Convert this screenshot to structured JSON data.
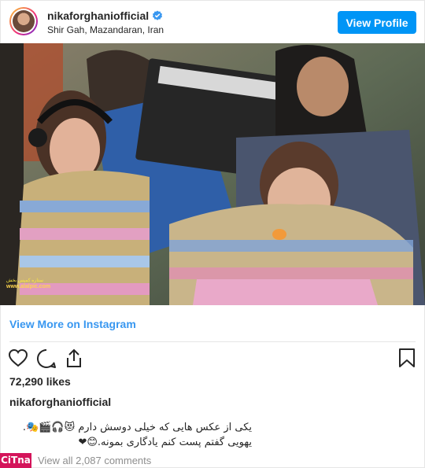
{
  "post": {
    "username": "nikaforghaniofficial",
    "location": "Shir Gah, Mazandaran, Iran",
    "view_profile_label": "View Profile",
    "view_more_label": "View More on Instagram",
    "likes": "72,290 likes",
    "caption_user": "nikaforghaniofficial",
    "caption_line1": "یکی از عکس هایی که خیلی دوسش دارم 😻🎧🎬🎭.",
    "caption_line2": "یهویی گفتم پست کنم یادگاری بمونه.😊❤",
    "comments_label": "View all 2,087 comments"
  },
  "watermark": {
    "text": "ستاره کمپس بخش",
    "url": "www.alalpic.com"
  },
  "badge": {
    "text": "CiTna"
  },
  "icons": [
    "heart-icon",
    "comment-icon",
    "share-icon",
    "bookmark-icon",
    "verified-icon"
  ],
  "colors": {
    "accent": "#0095f6",
    "link": "#3897f0",
    "verified": "#3897f0",
    "badge": "#d4145a"
  }
}
